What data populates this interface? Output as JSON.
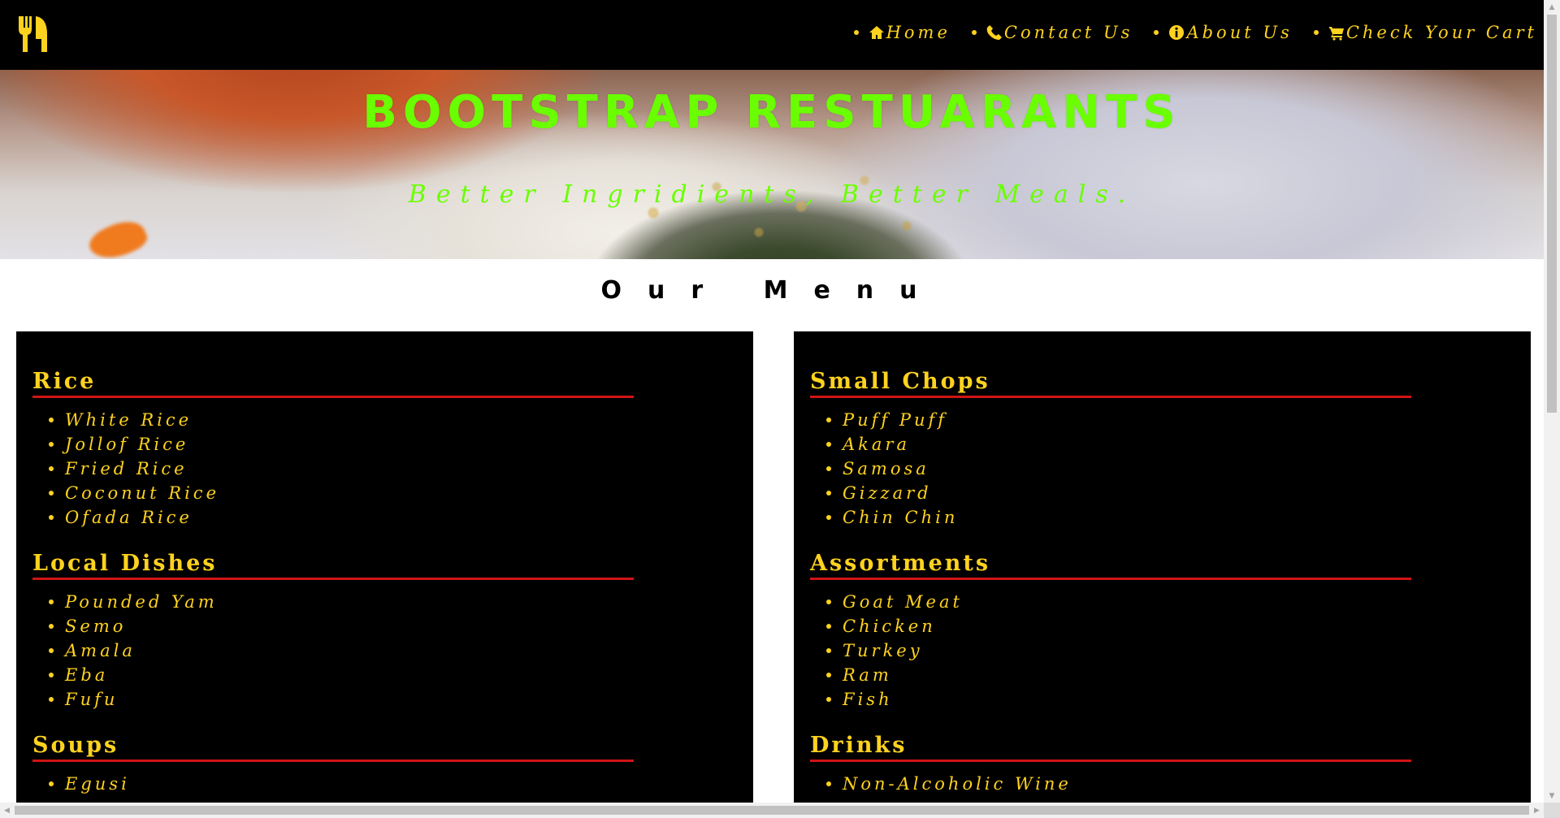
{
  "navbar": {
    "logo_icon": "fork-knife-icon",
    "items": [
      {
        "icon": "home-icon",
        "label": "Home"
      },
      {
        "icon": "phone-icon",
        "label": "Contact Us"
      },
      {
        "icon": "info-icon",
        "label": "About Us"
      },
      {
        "icon": "cart-icon",
        "label": "Check Your Cart"
      }
    ]
  },
  "hero": {
    "title": "BOOTSTRAP RESTUARANTS",
    "subtitle": "Better Ingridients, Better Meals."
  },
  "menu": {
    "heading": "Our Menu",
    "left": [
      {
        "title": "Rice",
        "items": [
          "White Rice",
          "Jollof Rice",
          "Fried Rice",
          "Coconut Rice",
          "Ofada Rice"
        ]
      },
      {
        "title": "Local Dishes",
        "items": [
          "Pounded Yam",
          "Semo",
          "Amala",
          "Eba",
          "Fufu"
        ]
      },
      {
        "title": "Soups",
        "items": [
          "Egusi"
        ]
      }
    ],
    "right": [
      {
        "title": "Small Chops",
        "items": [
          "Puff Puff",
          "Akara",
          "Samosa",
          "Gizzard",
          "Chin Chin"
        ]
      },
      {
        "title": "Assortments",
        "items": [
          "Goat Meat",
          "Chicken",
          "Turkey",
          "Ram",
          "Fish"
        ]
      },
      {
        "title": "Drinks",
        "items": [
          "Non-Alcoholic Wine"
        ]
      }
    ]
  },
  "colors": {
    "accent_yellow": "#ffd21f",
    "hero_green": "#6aff00",
    "divider_red": "#d11414",
    "navbar_bg": "#000000"
  }
}
